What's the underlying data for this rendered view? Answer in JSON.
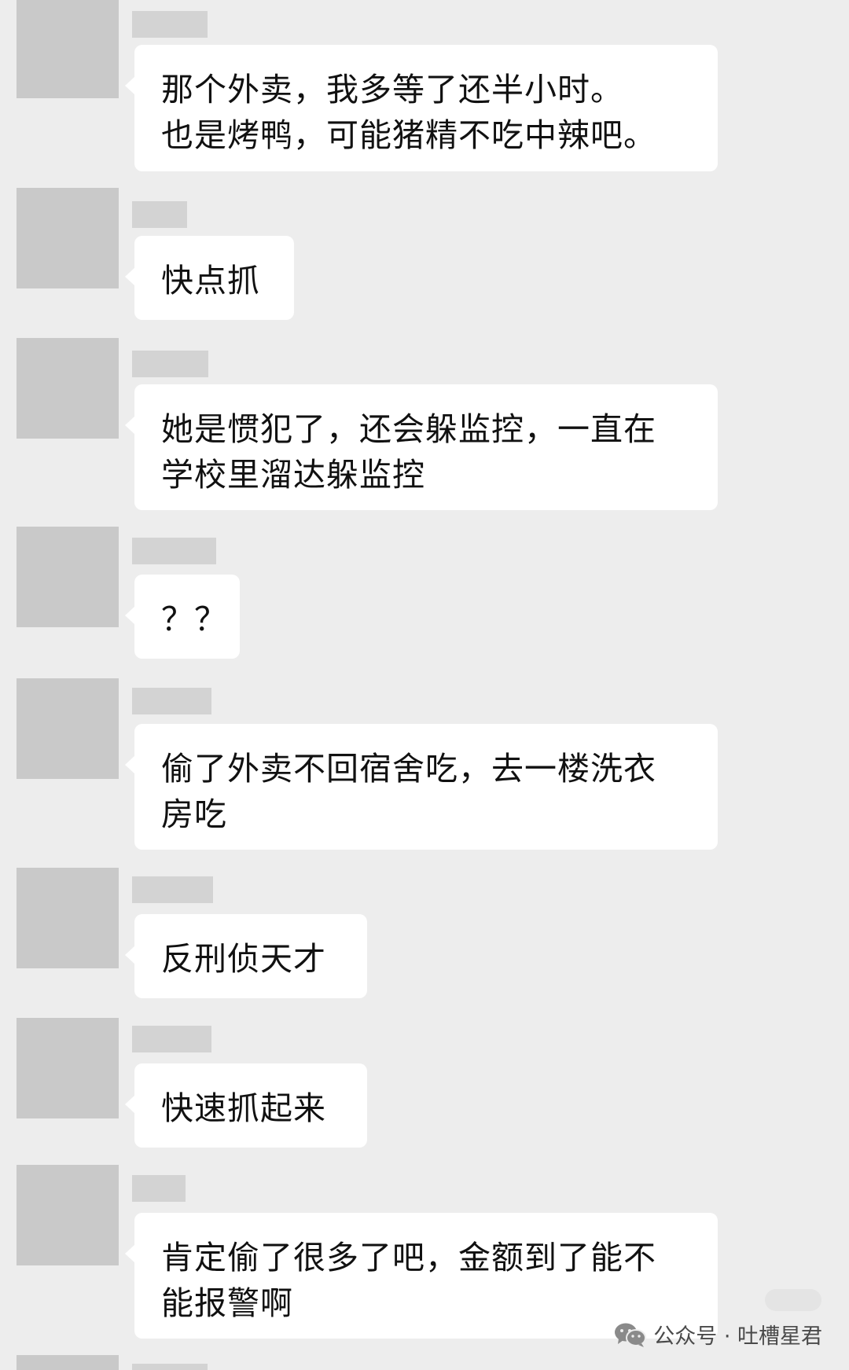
{
  "messages": [
    {
      "text": "那个外卖，我多等了还半小时。\n也是烤鸭，可能猪精不吃中辣吧。"
    },
    {
      "text": "快点抓"
    },
    {
      "text": "她是惯犯了，还会躲监控，一直在\n学校里溜达躲监控"
    },
    {
      "text": "？？"
    },
    {
      "text": "偷了外卖不回宿舍吃，去一楼洗衣\n房吃"
    },
    {
      "text": "反刑侦天才"
    },
    {
      "text": "快速抓起来"
    },
    {
      "text": "肯定偷了很多了吧，金额到了能不\n能报警啊"
    }
  ],
  "watermark": {
    "icon": "wechat-icon",
    "label": "公众号 · 吐槽星君"
  },
  "colors": {
    "background": "#ededed",
    "bubble": "#ffffff",
    "avatar_placeholder": "#c9c9c9",
    "name_placeholder": "#d3d3d3"
  }
}
